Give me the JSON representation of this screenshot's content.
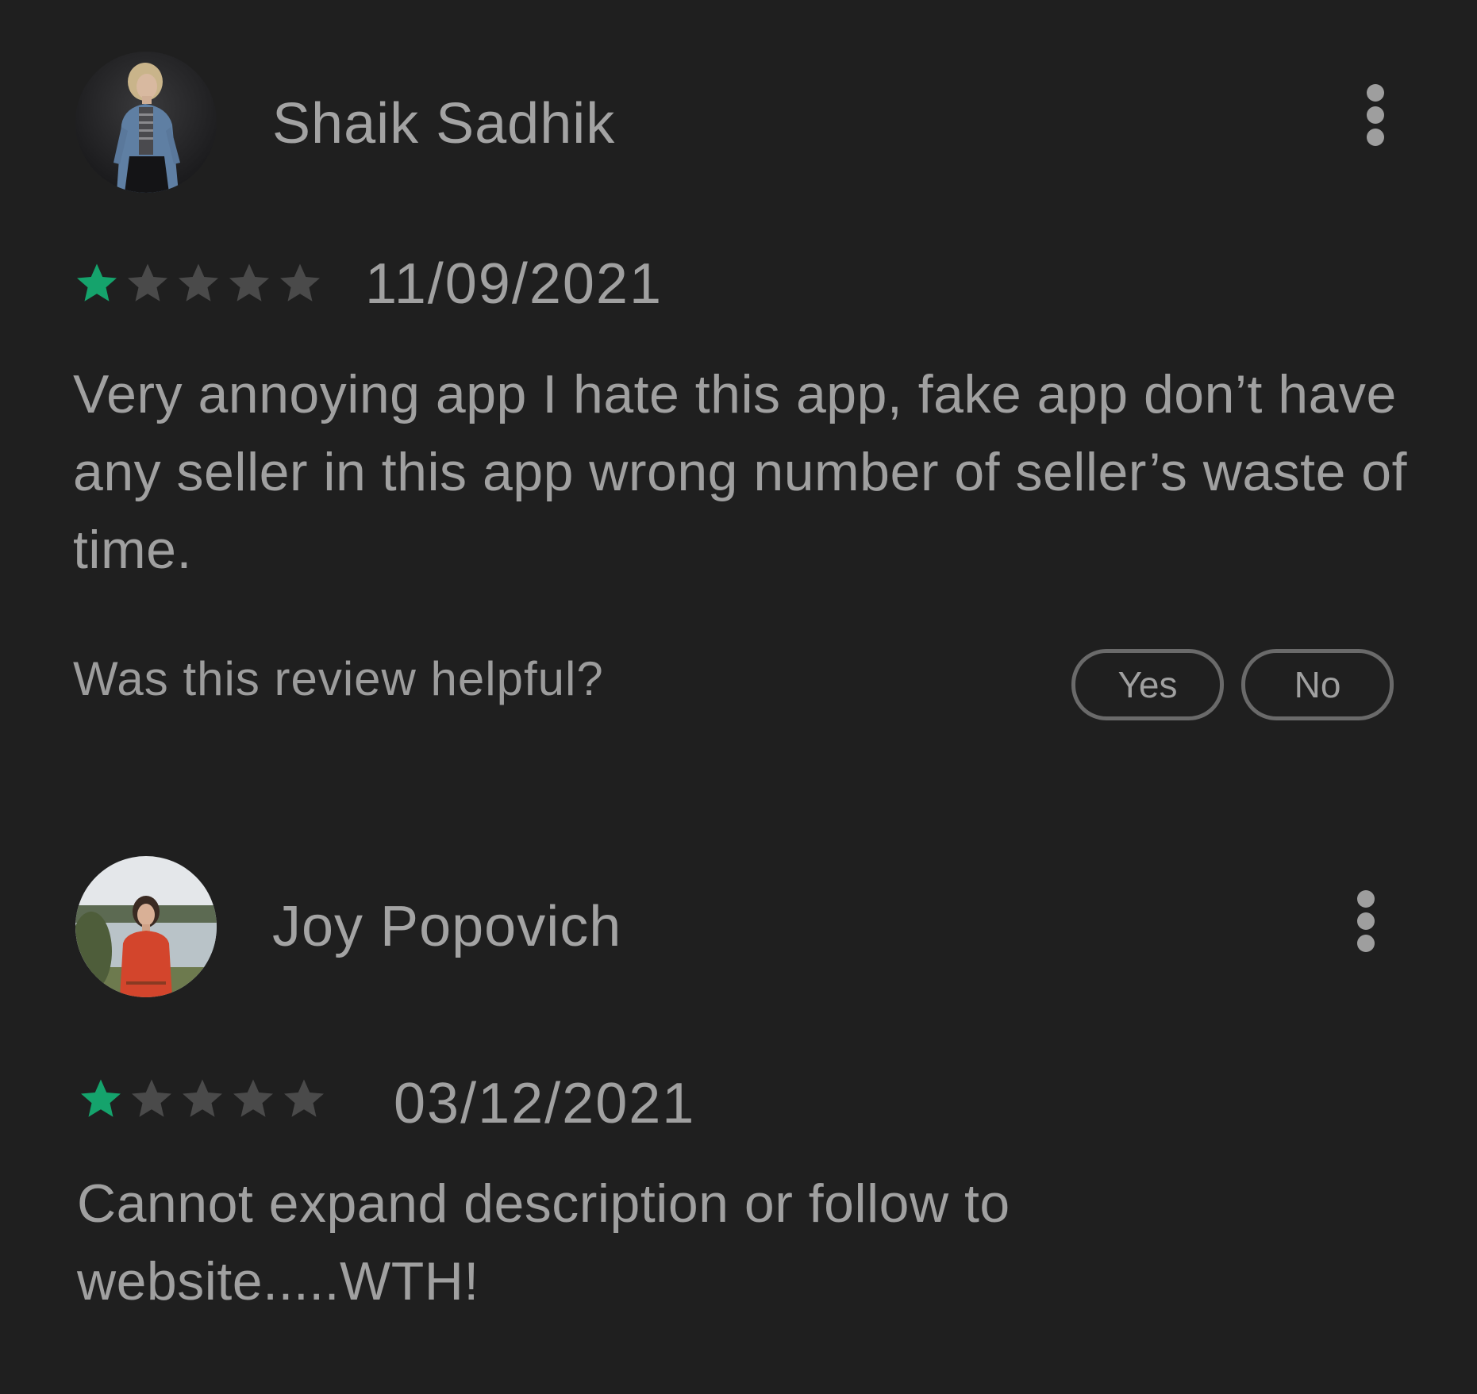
{
  "colors": {
    "background": "#1f1f1f",
    "text": "#a0a0a0",
    "star_filled": "#15a36c",
    "star_empty": "#4a4a4a",
    "button_border": "#6a6a6a"
  },
  "reviews": [
    {
      "reviewer_name": "Shaik Sadhik",
      "avatar_icon": "avatar-photo-denim-jacket",
      "menu_icon": "more-vertical-icon",
      "rating": 1,
      "rating_max": 5,
      "date": "11/09/2021",
      "text": "Very annoying app I hate this app, fake app don’t have any seller in this app wrong number of seller’s waste of time.",
      "helpful_question": "Was this review helpful?",
      "yes_label": "Yes",
      "no_label": "No"
    },
    {
      "reviewer_name": "Joy Popovich",
      "avatar_icon": "avatar-photo-red-sweater-lake",
      "menu_icon": "more-vertical-icon",
      "rating": 1,
      "rating_max": 5,
      "date": "03/12/2021",
      "text": "Cannot expand description or follow to website.....WTH!"
    }
  ]
}
